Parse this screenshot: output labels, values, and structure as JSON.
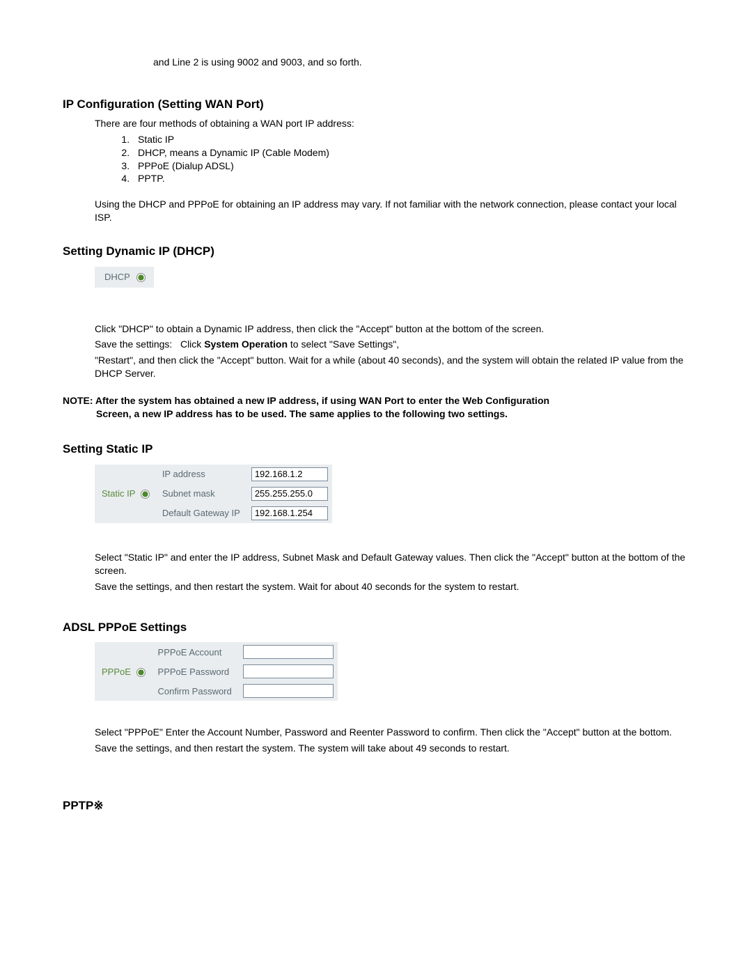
{
  "intro": "and Line 2 is using 9002 and 9003, and so forth.",
  "ipconfig": {
    "heading": "IP Configuration (Setting WAN Port)",
    "lead": "There are four methods of obtaining a WAN port IP address:",
    "items": [
      "Static IP",
      "DHCP, means a Dynamic IP (Cable Modem)",
      "PPPoE (Dialup ADSL)",
      "PPTP."
    ],
    "para": "Using the DHCP and PPPoE for obtaining an IP address may vary. If not familiar with the network connection, please contact your local ISP."
  },
  "dhcp": {
    "heading": "Setting Dynamic IP (DHCP)",
    "label": "DHCP",
    "p1a": "Click \"DHCP\" to obtain a Dynamic IP address, then click the \"Accept\" button at the bottom of the screen.",
    "p1b_prefix": "Save the settings:   Click ",
    "p1b_bold": "System Operation",
    "p1b_suffix": " to select \"Save Settings\",",
    "p1c": "\"Restart\", and then click the \"Accept\" button. Wait for a while (about 40 seconds), and the system will obtain the related IP value from the DHCP Server.",
    "note_line1": "NOTE: After the system has obtained a new IP address, if using WAN Port to enter the Web Configuration",
    "note_line2": "Screen, a new IP address has to be used. The same applies to the following two settings."
  },
  "staticip": {
    "heading": "Setting Static IP",
    "radio_label": "Static IP",
    "row1_label": "IP address",
    "row1_value": "192.168.1.2",
    "row2_label": "Subnet mask",
    "row2_value": "255.255.255.0",
    "row3_label": "Default Gateway IP",
    "row3_value": "192.168.1.254",
    "p1": "Select \"Static IP\" and enter the IP address, Subnet Mask and Default Gateway values. Then click the \"Accept\" button at the bottom of the screen.",
    "p2": "Save the settings, and then restart the system. Wait for about 40 seconds for the system to restart."
  },
  "pppoe": {
    "heading": "ADSL PPPoE Settings",
    "radio_label": "PPPoE",
    "row1_label": "PPPoE Account",
    "row2_label": "PPPoE Password",
    "row3_label": "Confirm Password",
    "p1": "Select \"PPPoE\" Enter the Account Number, Password and Reenter Password to confirm. Then click the \"Accept\" button at the bottom.",
    "p2": "Save the settings, and then restart the system. The system will take about 49 seconds to restart."
  },
  "pptp": {
    "heading": "PPTP※"
  }
}
